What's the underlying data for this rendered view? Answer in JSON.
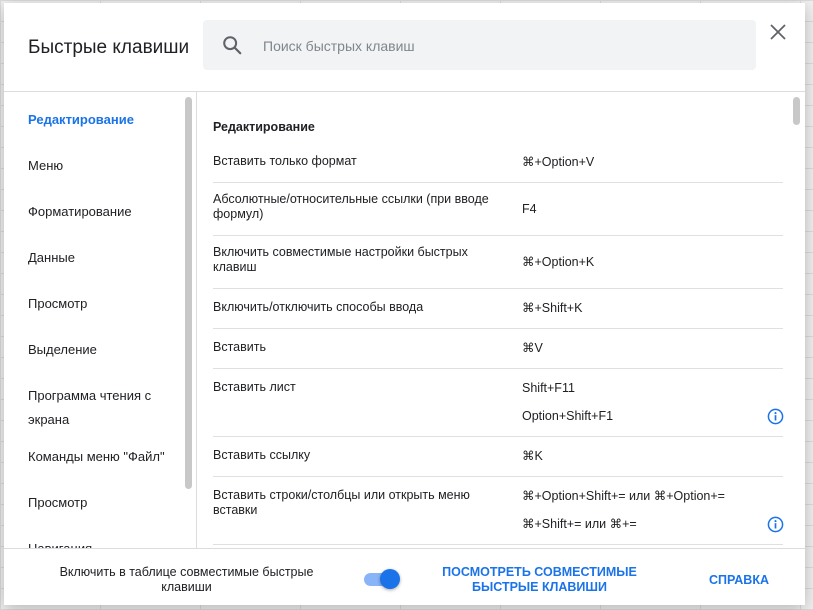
{
  "dialog": {
    "title": "Быстрые клавиши",
    "search_placeholder": "Поиск быстрых клавиш",
    "search_value": ""
  },
  "sidebar": {
    "items": [
      {
        "label": "Редактирование",
        "active": true
      },
      {
        "label": "Меню"
      },
      {
        "label": "Форматирование"
      },
      {
        "label": "Данные"
      },
      {
        "label": "Просмотр"
      },
      {
        "label": "Выделение"
      },
      {
        "label": "Программа чтения с экрана"
      },
      {
        "label": "Команды меню \"Файл\""
      },
      {
        "label": "Просмотр"
      },
      {
        "label": "Навигация"
      }
    ]
  },
  "content": {
    "section_title": "Редактирование",
    "rows": [
      {
        "name": "Вставить только формат",
        "keys": [
          "⌘+Option+V"
        ]
      },
      {
        "name": "Абсолютные/относительные ссылки (при вводе формул)",
        "keys": [
          "F4"
        ]
      },
      {
        "name": "Включить совместимые настройки быстрых клавиш",
        "keys": [
          "⌘+Option+K"
        ]
      },
      {
        "name": "Включить/отключить способы ввода",
        "keys": [
          "⌘+Shift+K"
        ]
      },
      {
        "name": "Вставить",
        "keys": [
          "⌘V"
        ]
      },
      {
        "name": "Вставить лист",
        "keys": [
          "Shift+F11",
          "Option+Shift+F1"
        ],
        "info": "info-icon"
      },
      {
        "name": "Вставить ссылку",
        "keys": [
          "⌘K"
        ]
      },
      {
        "name": "Вставить строки/столбцы или открыть меню вставки",
        "keys": [
          "⌘+Option+Shift+= или ⌘+Option+=",
          "⌘+Shift+= или ⌘+="
        ],
        "info": "info-icon"
      }
    ]
  },
  "footer": {
    "toggle_label": "Включить в таблице совместимые быстрые клавиши",
    "toggle_on": true,
    "view_compatible": "ПОСМОТРЕТЬ СОВМЕСТИМЫЕ БЫСТРЫЕ КЛАВИШИ",
    "help": "СПРАВКА"
  },
  "colors": {
    "accent": "#1a73e8",
    "toggle_track": "#8ab4f8",
    "search_bg": "#f1f3f4"
  }
}
